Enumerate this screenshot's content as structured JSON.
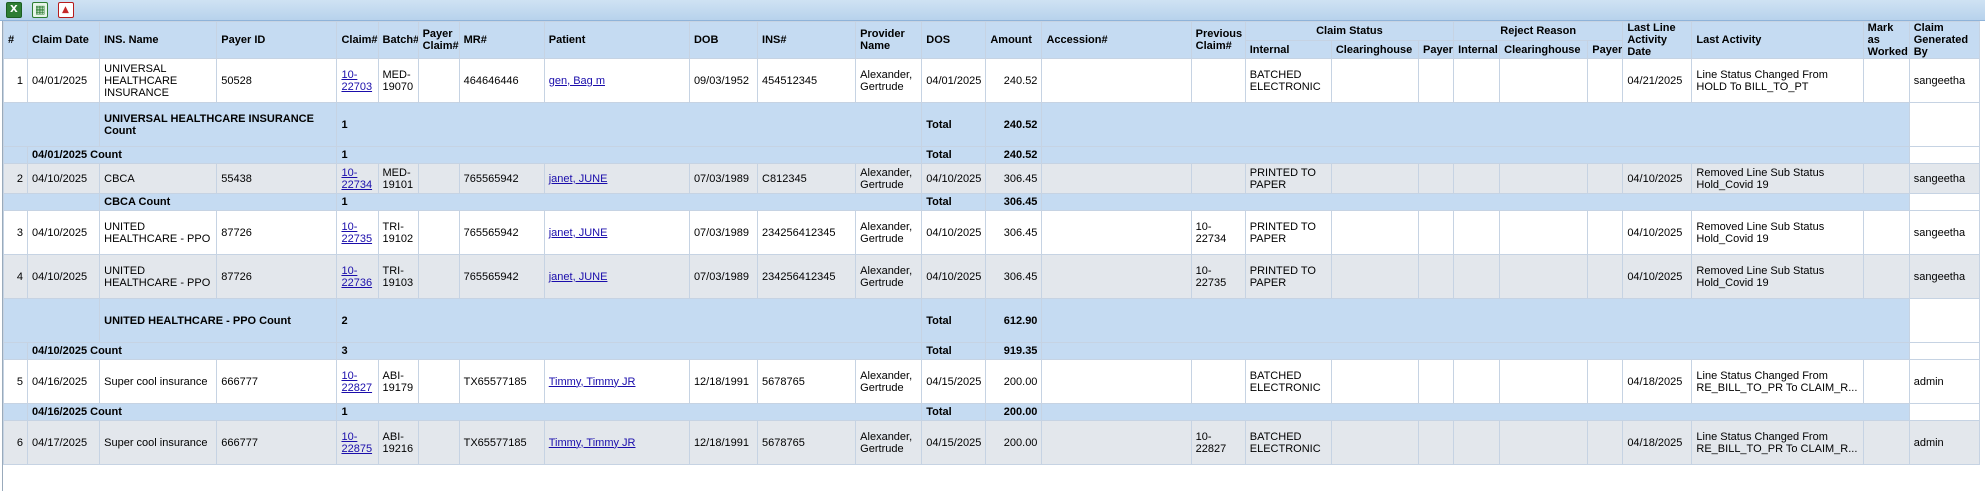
{
  "toolbar": {
    "icons": [
      "excel-export-icon",
      "excel-sheet-icon",
      "pdf-export-icon"
    ]
  },
  "headers": {
    "num": "#",
    "claim_date": "Claim Date",
    "ins_name": "INS. Name",
    "payer_id": "Payer ID",
    "claim_no": "Claim#",
    "batch_no": "Batch#",
    "payer_claim": "Payer Claim#",
    "mr": "MR#",
    "patient": "Patient",
    "dob": "DOB",
    "ins_no": "INS#",
    "provider": "Provider Name",
    "dos": "DOS",
    "amount": "Amount",
    "accession": "Accession#",
    "prev_claim": "Previous Claim#",
    "claim_status": "Claim Status",
    "reject_reason": "Reject Reason",
    "internal": "Internal",
    "clearinghouse": "Clearinghouse",
    "payer": "Payer",
    "last_line_activity_date": "Last Line Activity Date",
    "last_activity": "Last Activity",
    "mark_as_worked": "Mark as Worked",
    "claim_generated_by": "Claim Generated By"
  },
  "rows": [
    {
      "num": "1",
      "claim_date": "04/01/2025",
      "ins_name": "UNIVERSAL HEALTHCARE INSURANCE",
      "payer_id": "50528",
      "claim_no": "10-22703",
      "batch_no": "MED-19070",
      "mr": "464646446",
      "patient": "gen, Bag m",
      "dob": "09/03/1952",
      "ins_no": "454512345",
      "provider": "Alexander, Gertrude",
      "dos": "04/01/2025",
      "amount": "240.52",
      "prev_claim": "",
      "internal_status": "BATCHED ELECTRONIC",
      "last_date": "04/21/2025",
      "last_activity": "Line Status Changed From HOLD To BILL_TO_PT",
      "generated_by": "sangeetha"
    },
    {
      "num": "2",
      "claim_date": "04/10/2025",
      "ins_name": "CBCA",
      "payer_id": "55438",
      "claim_no": "10-22734",
      "batch_no": "MED-19101",
      "mr": "765565942",
      "patient": "janet, JUNE",
      "dob": "07/03/1989",
      "ins_no": "C812345",
      "provider": "Alexander, Gertrude",
      "dos": "04/10/2025",
      "amount": "306.45",
      "prev_claim": "",
      "internal_status": "PRINTED TO PAPER",
      "last_date": "04/10/2025",
      "last_activity": "Removed Line Sub Status Hold_Covid 19",
      "generated_by": "sangeetha"
    },
    {
      "num": "3",
      "claim_date": "04/10/2025",
      "ins_name": "UNITED HEALTHCARE - PPO",
      "payer_id": "87726",
      "claim_no": "10-22735",
      "batch_no": "TRI-19102",
      "mr": "765565942",
      "patient": "janet, JUNE",
      "dob": "07/03/1989",
      "ins_no": "234256412345",
      "provider": "Alexander, Gertrude",
      "dos": "04/10/2025",
      "amount": "306.45",
      "prev_claim": "10-22734",
      "internal_status": "PRINTED TO PAPER",
      "last_date": "04/10/2025",
      "last_activity": "Removed Line Sub Status Hold_Covid 19",
      "generated_by": "sangeetha"
    },
    {
      "num": "4",
      "claim_date": "04/10/2025",
      "ins_name": "UNITED HEALTHCARE - PPO",
      "payer_id": "87726",
      "claim_no": "10-22736",
      "batch_no": "TRI-19103",
      "mr": "765565942",
      "patient": "janet, JUNE",
      "dob": "07/03/1989",
      "ins_no": "234256412345",
      "provider": "Alexander, Gertrude",
      "dos": "04/10/2025",
      "amount": "306.45",
      "prev_claim": "10-22735",
      "internal_status": "PRINTED TO PAPER",
      "last_date": "04/10/2025",
      "last_activity": "Removed Line Sub Status Hold_Covid 19",
      "generated_by": "sangeetha"
    },
    {
      "num": "5",
      "claim_date": "04/16/2025",
      "ins_name": "Super cool insurance",
      "payer_id": "666777",
      "claim_no": "10-22827",
      "batch_no": "ABI-19179",
      "mr": "TX65577185",
      "patient": "Timmy, Timmy JR",
      "dob": "12/18/1991",
      "ins_no": "5678765",
      "provider": "Alexander, Gertrude",
      "dos": "04/15/2025",
      "amount": "200.00",
      "prev_claim": "",
      "internal_status": "BATCHED ELECTRONIC",
      "last_date": "04/18/2025",
      "last_activity": "Line Status Changed From RE_BILL_TO_PR To CLAIM_R...",
      "generated_by": "admin"
    },
    {
      "num": "6",
      "claim_date": "04/17/2025",
      "ins_name": "Super cool insurance",
      "payer_id": "666777",
      "claim_no": "10-22875",
      "batch_no": "ABI-19216",
      "mr": "TX65577185",
      "patient": "Timmy, Timmy JR",
      "dob": "12/18/1991",
      "ins_no": "5678765",
      "provider": "Alexander, Gertrude",
      "dos": "04/15/2025",
      "amount": "200.00",
      "prev_claim": "10-22827",
      "internal_status": "BATCHED ELECTRONIC",
      "last_date": "04/18/2025",
      "last_activity": "Line Status Changed From RE_BILL_TO_PR To CLAIM_R...",
      "generated_by": "admin"
    }
  ],
  "summaries": {
    "s1": {
      "label": "UNIVERSAL HEALTHCARE INSURANCE Count",
      "count": "1",
      "total_label": "Total",
      "total": "240.52"
    },
    "s2": {
      "label": "04/01/2025 Count",
      "count": "1",
      "total_label": "Total",
      "total": "240.52"
    },
    "s3": {
      "label": "CBCA Count",
      "count": "1",
      "total_label": "Total",
      "total": "306.45"
    },
    "s4": {
      "label": "UNITED HEALTHCARE - PPO Count",
      "count": "2",
      "total_label": "Total",
      "total": "612.90"
    },
    "s5": {
      "label": "04/10/2025 Count",
      "count": "3",
      "total_label": "Total",
      "total": "919.35"
    },
    "s6": {
      "label": "04/16/2025 Count",
      "count": "1",
      "total_label": "Total",
      "total": "200.00"
    }
  },
  "colors": {
    "header_bg": "#c5dbf2",
    "alt_row_bg": "#e3e7ec",
    "link": "#1a0dab"
  }
}
